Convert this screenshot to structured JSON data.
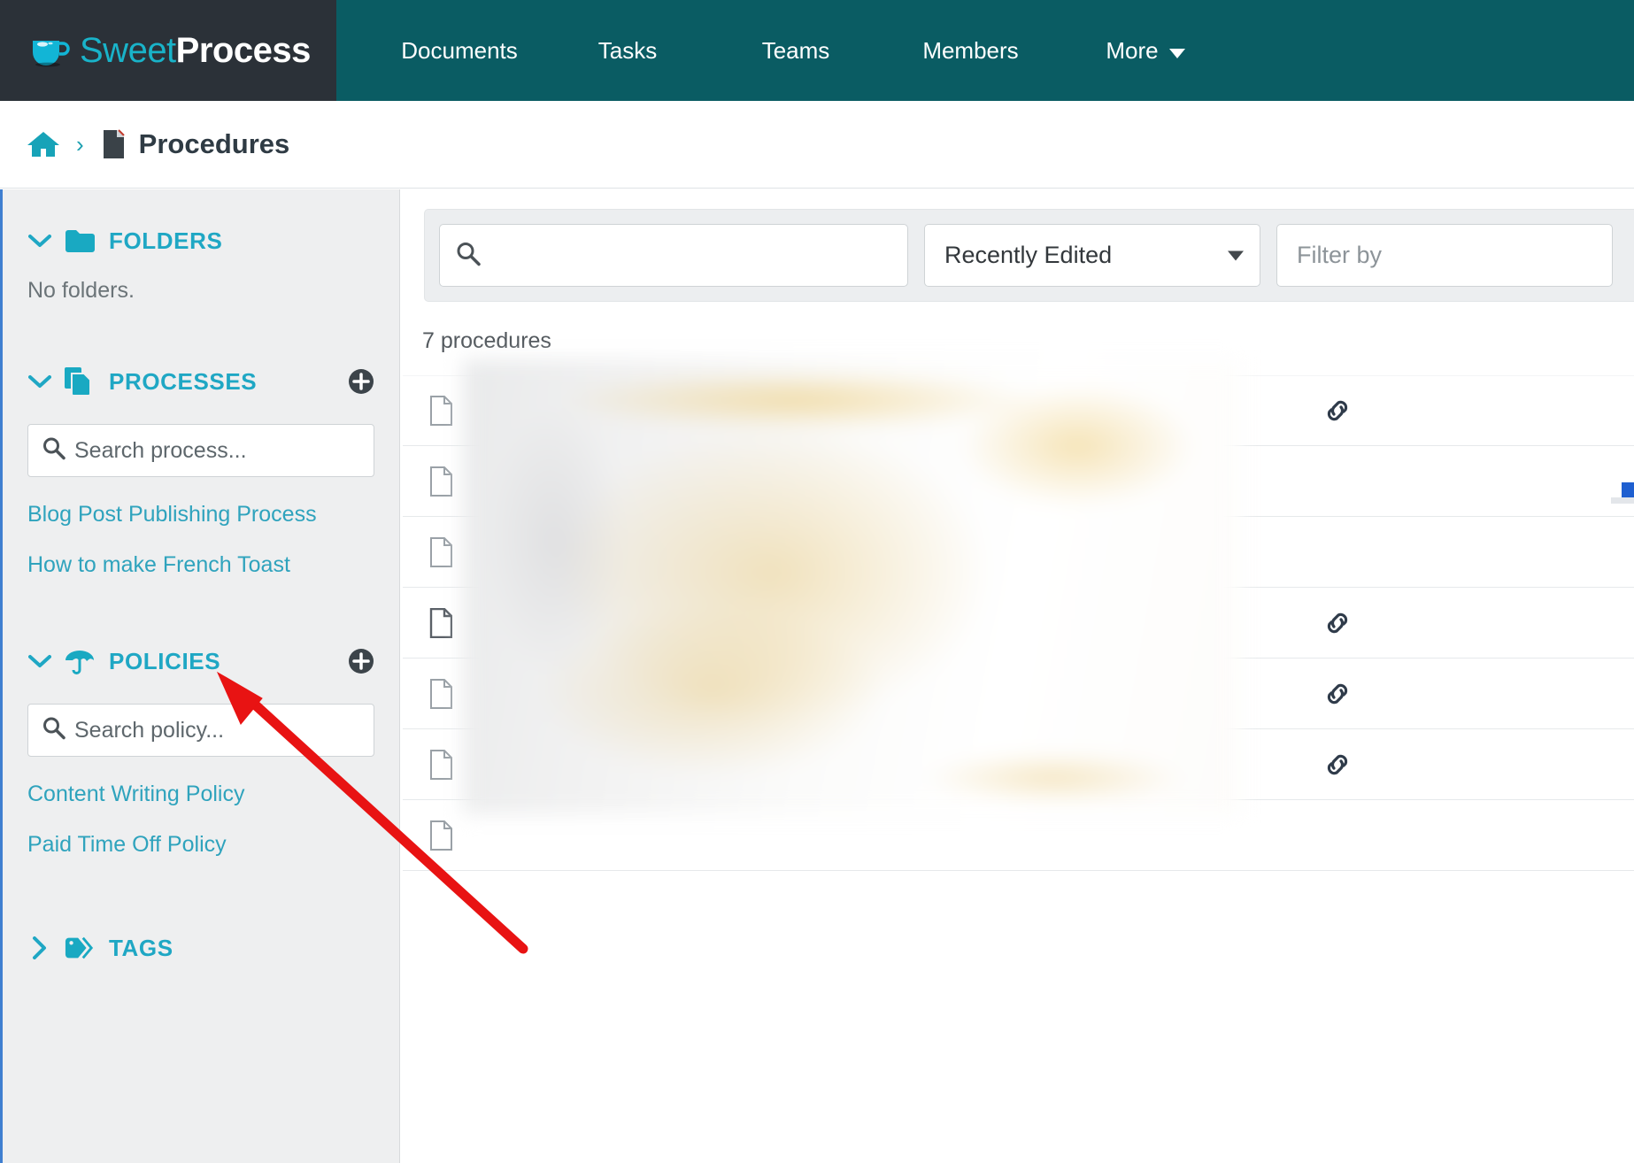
{
  "header": {
    "brand": {
      "sweet": "Sweet",
      "process": "Process",
      "icon": "coffee-cup-icon"
    },
    "nav": [
      {
        "label": "Documents"
      },
      {
        "label": "Tasks"
      },
      {
        "label": "Teams"
      },
      {
        "label": "Members"
      },
      {
        "label": "More",
        "has_caret": true
      }
    ]
  },
  "breadcrumb": {
    "home_icon": "home-icon",
    "separator": "›",
    "doc_icon": "document-icon",
    "title": "Procedures"
  },
  "sidebar": {
    "folders": {
      "label": "FOLDERS",
      "icon": "folder-icon",
      "chevron": "chevron-down-icon",
      "empty_text": "No folders."
    },
    "processes": {
      "label": "PROCESSES",
      "icon": "copy-documents-icon",
      "chevron": "chevron-down-icon",
      "add_icon": "plus-circle-icon",
      "search_placeholder": "Search process...",
      "items": [
        {
          "label": "Blog Post Publishing Process"
        },
        {
          "label": "How to make French Toast"
        }
      ]
    },
    "policies": {
      "label": "POLICIES",
      "icon": "umbrella-icon",
      "chevron": "chevron-down-icon",
      "add_icon": "plus-circle-icon",
      "search_placeholder": "Search policy...",
      "items": [
        {
          "label": "Content Writing Policy"
        },
        {
          "label": "Paid Time Off Policy"
        }
      ]
    },
    "tags": {
      "label": "TAGS",
      "icon": "tag-icon",
      "chevron": "chevron-right-icon"
    }
  },
  "main": {
    "toolbar": {
      "search_value": "",
      "search_placeholder": "",
      "search_icon": "search-icon",
      "sort_value": "Recently Edited",
      "sort_caret": "chevron-down-icon",
      "filter_placeholder": "Filter by"
    },
    "count_text": "7 procedures",
    "rows": [
      {
        "doc_icon": "document-icon",
        "title": "",
        "link_icon": "link-icon",
        "has_link": true
      },
      {
        "doc_icon": "document-icon",
        "title": "",
        "link_icon": "link-icon",
        "has_link": false
      },
      {
        "doc_icon": "document-icon",
        "title": "",
        "link_icon": "link-icon",
        "has_link": false
      },
      {
        "doc_icon": "document-icon",
        "title": "",
        "link_icon": "link-icon",
        "has_link": true
      },
      {
        "doc_icon": "document-icon",
        "title": "",
        "link_icon": "link-icon",
        "has_link": true
      },
      {
        "doc_icon": "document-icon",
        "title": "",
        "link_icon": "link-icon",
        "has_link": true
      },
      {
        "doc_icon": "document-icon",
        "title": "",
        "link_icon": "link-icon",
        "has_link": false
      }
    ]
  },
  "annotation": {
    "arrow_icon": "red-arrow-annotation",
    "color": "#e81313",
    "points_to": "POLICIES"
  },
  "colors": {
    "nav_bar": "#0a5c63",
    "brand_bar": "#2b3138",
    "accent_teal": "#1fa7c4",
    "link_blue": "#2a6fb0",
    "sidebar_bg": "#eeeff0",
    "annotation_red": "#e81313"
  }
}
